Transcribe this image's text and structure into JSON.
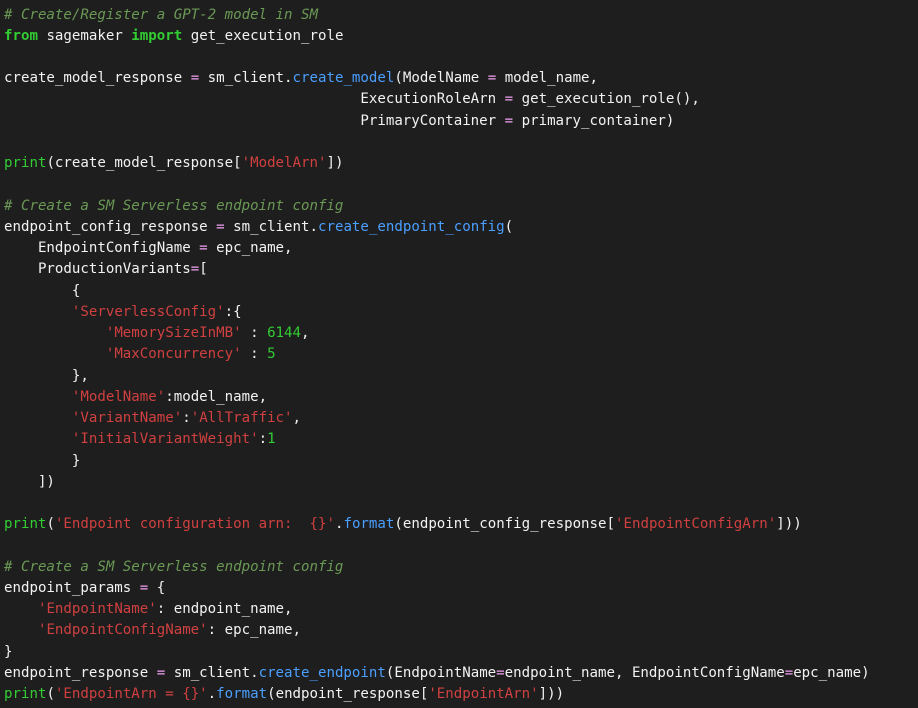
{
  "editor": {
    "colors": {
      "background": "#1e1e1e",
      "comment": "#6a9955",
      "keyword": "#33cc33",
      "function": "#4a9fff",
      "string": "#d04040",
      "number": "#33cc33",
      "operator": "#f0a0f0",
      "plain": "#f2f2f2"
    },
    "lines": [
      [
        [
          "comment",
          "# Create/Register a GPT-2 model in SM"
        ]
      ],
      [
        [
          "keyword",
          "from"
        ],
        [
          "plain",
          " sagemaker "
        ],
        [
          "keyword",
          "import"
        ],
        [
          "plain",
          " get_execution_role"
        ]
      ],
      [],
      [
        [
          "plain",
          "create_model_response "
        ],
        [
          "op",
          "="
        ],
        [
          "plain",
          " sm_client."
        ],
        [
          "func",
          "create_model"
        ],
        [
          "plain",
          "(ModelName "
        ],
        [
          "op",
          "="
        ],
        [
          "plain",
          " model_name,"
        ]
      ],
      [
        [
          "plain",
          "                                          ExecutionRoleArn "
        ],
        [
          "op",
          "="
        ],
        [
          "plain",
          " get_execution_role(),"
        ]
      ],
      [
        [
          "plain",
          "                                          PrimaryContainer "
        ],
        [
          "op",
          "="
        ],
        [
          "plain",
          " primary_container)"
        ]
      ],
      [],
      [
        [
          "builtin",
          "print"
        ],
        [
          "plain",
          "(create_model_response["
        ],
        [
          "string",
          "'ModelArn'"
        ],
        [
          "plain",
          "])"
        ]
      ],
      [],
      [
        [
          "comment",
          "# Create a SM Serverless endpoint config"
        ]
      ],
      [
        [
          "plain",
          "endpoint_config_response "
        ],
        [
          "op",
          "="
        ],
        [
          "plain",
          " sm_client."
        ],
        [
          "func",
          "create_endpoint_config"
        ],
        [
          "plain",
          "("
        ]
      ],
      [
        [
          "plain",
          "    EndpointConfigName "
        ],
        [
          "op",
          "="
        ],
        [
          "plain",
          " epc_name,"
        ]
      ],
      [
        [
          "plain",
          "    ProductionVariants"
        ],
        [
          "op",
          "="
        ],
        [
          "plain",
          "["
        ]
      ],
      [
        [
          "plain",
          "        {"
        ]
      ],
      [
        [
          "plain",
          "        "
        ],
        [
          "string",
          "'ServerlessConfig'"
        ],
        [
          "plain",
          ":{"
        ]
      ],
      [
        [
          "plain",
          "            "
        ],
        [
          "string",
          "'MemorySizeInMB'"
        ],
        [
          "plain",
          " : "
        ],
        [
          "number",
          "6144"
        ],
        [
          "plain",
          ","
        ]
      ],
      [
        [
          "plain",
          "            "
        ],
        [
          "string",
          "'MaxConcurrency'"
        ],
        [
          "plain",
          " : "
        ],
        [
          "number",
          "5"
        ]
      ],
      [
        [
          "plain",
          "        },"
        ]
      ],
      [
        [
          "plain",
          "        "
        ],
        [
          "string",
          "'ModelName'"
        ],
        [
          "plain",
          ":model_name,"
        ]
      ],
      [
        [
          "plain",
          "        "
        ],
        [
          "string",
          "'VariantName'"
        ],
        [
          "plain",
          ":"
        ],
        [
          "string",
          "'AllTraffic'"
        ],
        [
          "plain",
          ","
        ]
      ],
      [
        [
          "plain",
          "        "
        ],
        [
          "string",
          "'InitialVariantWeight'"
        ],
        [
          "plain",
          ":"
        ],
        [
          "number",
          "1"
        ]
      ],
      [
        [
          "plain",
          "        }"
        ]
      ],
      [
        [
          "plain",
          "    ])"
        ]
      ],
      [],
      [
        [
          "builtin",
          "print"
        ],
        [
          "plain",
          "("
        ],
        [
          "string",
          "'Endpoint configuration arn:  {}'"
        ],
        [
          "plain",
          "."
        ],
        [
          "func",
          "format"
        ],
        [
          "plain",
          "(endpoint_config_response["
        ],
        [
          "string",
          "'EndpointConfigArn'"
        ],
        [
          "plain",
          "]))"
        ]
      ],
      [],
      [
        [
          "comment",
          "# Create a SM Serverless endpoint config"
        ]
      ],
      [
        [
          "plain",
          "endpoint_params "
        ],
        [
          "op",
          "="
        ],
        [
          "plain",
          " {"
        ]
      ],
      [
        [
          "plain",
          "    "
        ],
        [
          "string",
          "'EndpointName'"
        ],
        [
          "plain",
          ": endpoint_name,"
        ]
      ],
      [
        [
          "plain",
          "    "
        ],
        [
          "string",
          "'EndpointConfigName'"
        ],
        [
          "plain",
          ": epc_name,"
        ]
      ],
      [
        [
          "plain",
          "}"
        ]
      ],
      [
        [
          "plain",
          "endpoint_response "
        ],
        [
          "op",
          "="
        ],
        [
          "plain",
          " sm_client."
        ],
        [
          "func",
          "create_endpoint"
        ],
        [
          "plain",
          "(EndpointName"
        ],
        [
          "op",
          "="
        ],
        [
          "plain",
          "endpoint_name, EndpointConfigName"
        ],
        [
          "op",
          "="
        ],
        [
          "plain",
          "epc_name)"
        ]
      ],
      [
        [
          "builtin",
          "print"
        ],
        [
          "plain",
          "("
        ],
        [
          "string",
          "'EndpointArn = {}'"
        ],
        [
          "plain",
          "."
        ],
        [
          "func",
          "format"
        ],
        [
          "plain",
          "(endpoint_response["
        ],
        [
          "string",
          "'EndpointArn'"
        ],
        [
          "plain",
          "]))"
        ]
      ]
    ]
  }
}
